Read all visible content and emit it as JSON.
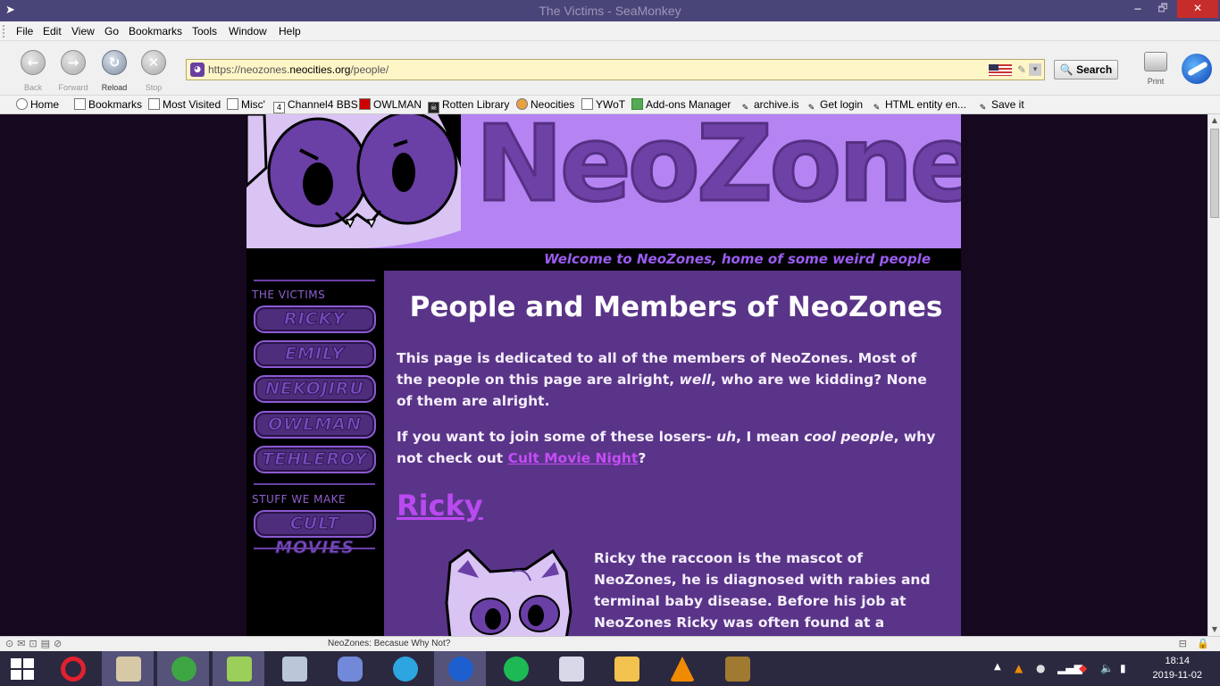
{
  "window": {
    "title": "The Victims - SeaMonkey",
    "minimize": "🗕",
    "maximize": "🗗",
    "close": "✕"
  },
  "menubar": [
    "File",
    "Edit",
    "View",
    "Go",
    "Bookmarks",
    "Tools",
    "Window",
    "Help"
  ],
  "navbar": {
    "back": "Back",
    "forward": "Forward",
    "reload": "Reload",
    "stop": "Stop",
    "url_prefix": "https://neozones.",
    "url_host": "neocities.org",
    "url_path": "/people/",
    "search": "Search",
    "print": "Print"
  },
  "bookmarks": [
    "Home",
    "Bookmarks",
    "Most Visited",
    "Misc'",
    "Channel4 BBS",
    "OWLMAN",
    "Rotten Library",
    "Neocities",
    "YWoT",
    "Add-ons Manager",
    "archive.is",
    "Get login",
    "HTML entity en...",
    "Save it"
  ],
  "page": {
    "logo": "NeoZones",
    "welcome": "Welcome to NeoZones, home of some weird people",
    "sidebar": {
      "heading_victims": "THE VICTIMS",
      "victims": [
        "RICKY",
        "EMILY",
        "NEKOJIRU",
        "OWLMAN",
        "TEHLEROY"
      ],
      "heading_stuff": "STUFF WE MAKE",
      "stuff": [
        "CULT MOVIES"
      ]
    },
    "title": "People and Members of NeoZones",
    "intro_1": "This page is dedicated to all of the members of NeoZones. Most of the people on this page are alright, ",
    "intro_1_em": "well",
    "intro_1_end": ", who are we kidding? None of them are alright.",
    "intro_2_a": "If you want to join some of these losers- ",
    "intro_2_em1": "uh",
    "intro_2_b": ", I mean ",
    "intro_2_em2": "cool people",
    "intro_2_c": ", why not check out ",
    "intro_2_link": "Cult Movie Night",
    "intro_2_end": "?",
    "ricky_heading": "Ricky",
    "ricky_bio": "Ricky the raccoon is the mascot of NeoZones, he is diagnosed with rabies and terminal baby disease. Before his job at NeoZones Ricky was often found at a dumpster behind a local"
  },
  "statusbar": {
    "text": "NeoZones: Becasue Why Not?"
  },
  "taskbar": {
    "time": "18:14",
    "date": "2019-11-02"
  }
}
